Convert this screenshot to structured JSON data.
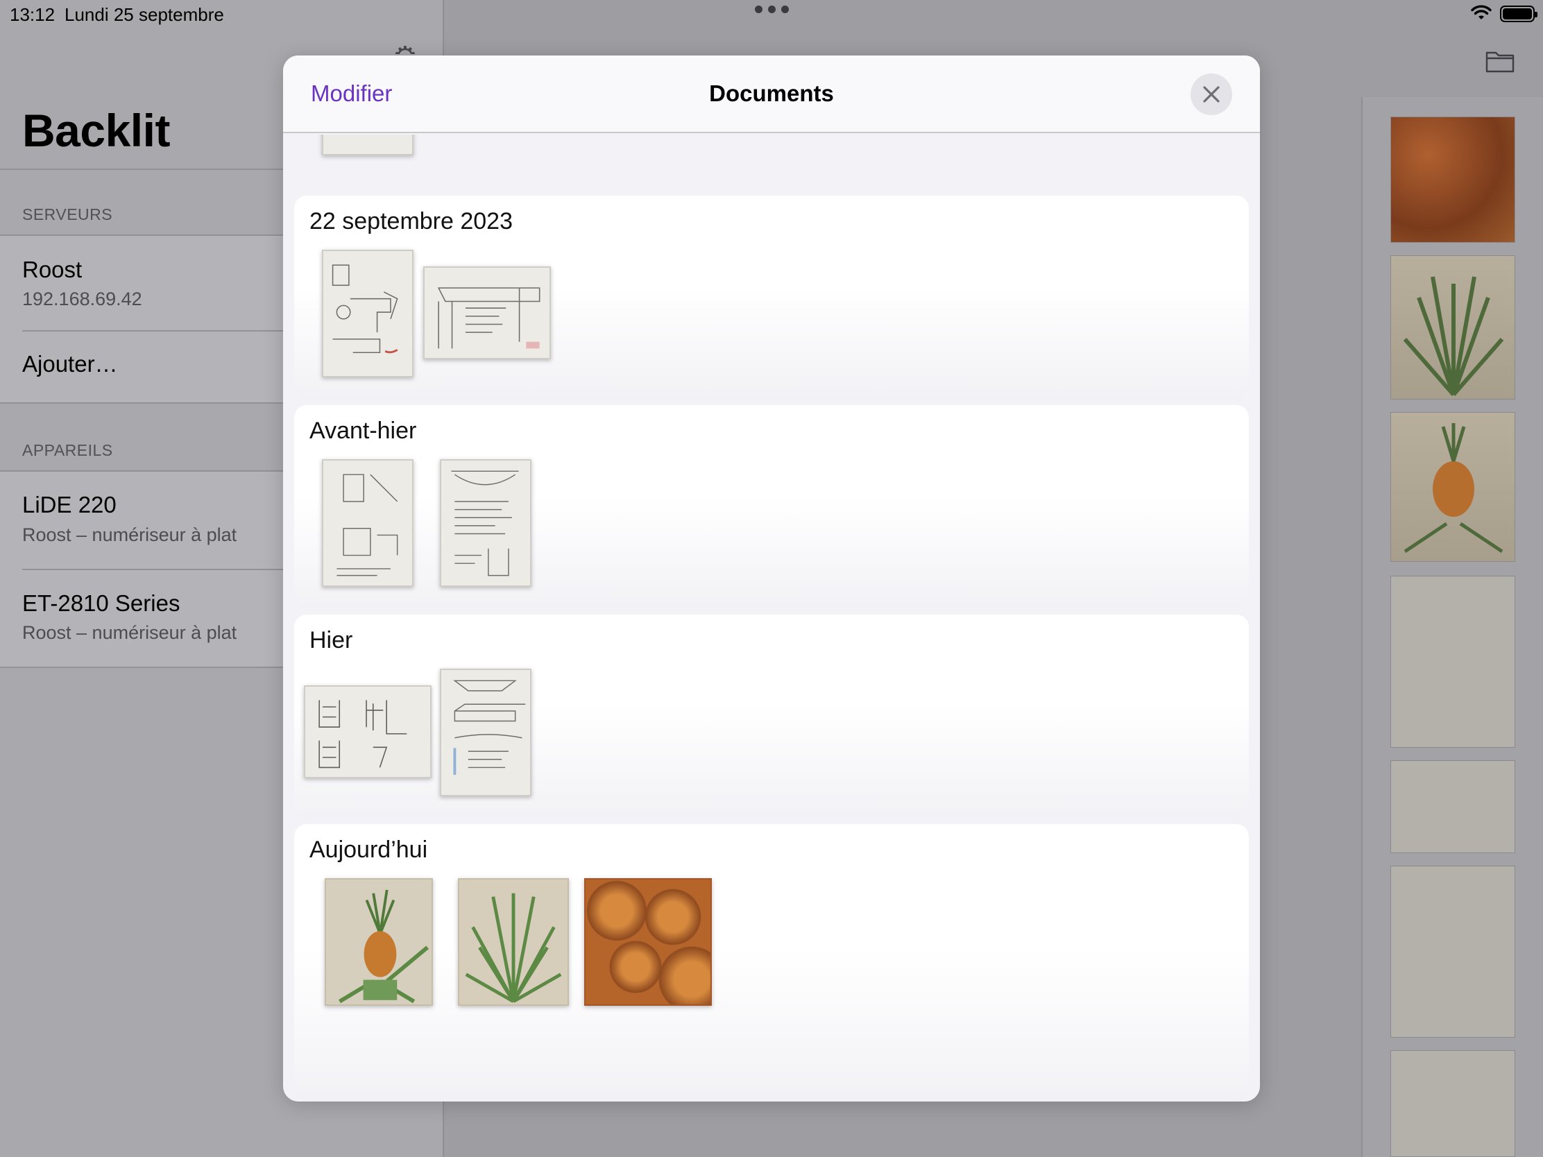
{
  "status_bar": {
    "time": "13:12",
    "date": "Lundi 25 septembre"
  },
  "sidebar": {
    "app_title": "Backlit",
    "servers_header": "SERVEURS",
    "server": {
      "name": "Roost",
      "address": "192.168.69.42"
    },
    "add_label": "Ajouter…",
    "devices_header": "APPAREILS",
    "devices": [
      {
        "name": "LiDE 220",
        "subtitle": "Roost – numériseur à plat"
      },
      {
        "name": "ET-2810 Series",
        "subtitle": "Roost – numériseur à plat"
      }
    ]
  },
  "modal": {
    "edit_label": "Modifier",
    "title": "Documents",
    "sections": [
      {
        "title": "22 septembre 2023"
      },
      {
        "title": "Avant-hier"
      },
      {
        "title": "Hier"
      },
      {
        "title": "Aujourd’hui"
      }
    ]
  },
  "icons": {
    "close": "close-icon",
    "gear": "gear-icon",
    "folder": "folder-icon",
    "wifi": "wifi-icon",
    "battery": "battery-icon"
  },
  "colors": {
    "accent": "#6a34c0",
    "modal_bg": "#f2f2f7"
  }
}
